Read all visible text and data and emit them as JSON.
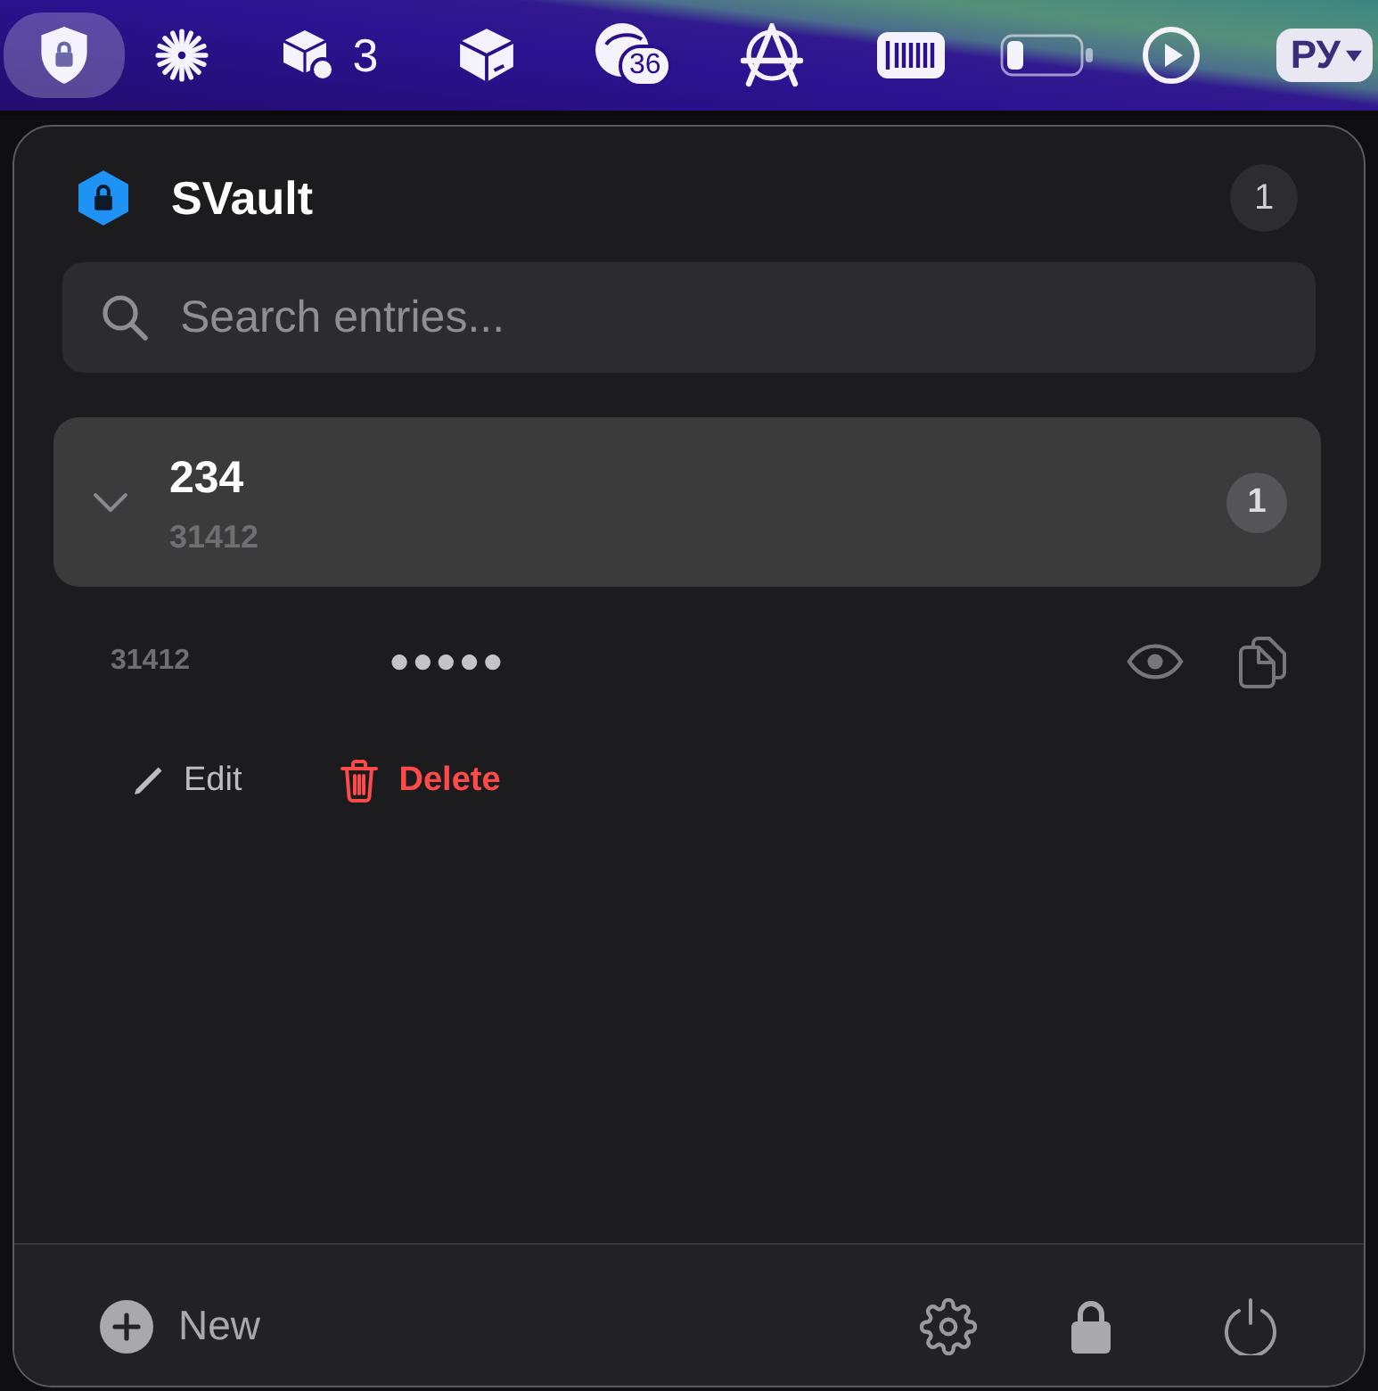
{
  "menu_bar": {
    "items": [
      {
        "selected": true
      },
      {
        "selected": false
      },
      {
        "selected": false,
        "label": "3"
      },
      {
        "selected": false
      },
      {
        "selected": false,
        "badge": "36"
      },
      {
        "selected": false
      },
      {
        "selected": false
      },
      {
        "selected": false
      },
      {
        "selected": false
      },
      {
        "selected": false,
        "label": "РУ"
      }
    ]
  },
  "app": {
    "title": "SVault",
    "count": "1"
  },
  "search": {
    "placeholder": "Search entries..."
  },
  "groups": [
    {
      "name": "234",
      "subtitle": "31412",
      "count": "1",
      "expanded": true,
      "entries": [
        {
          "username": "31412",
          "password": "●●●●●",
          "actions": [
            {
              "kind": "edit",
              "label": "Edit"
            },
            {
              "kind": "delete",
              "label": "Delete"
            }
          ]
        }
      ]
    }
  ],
  "footer": {
    "new_label": "New"
  }
}
